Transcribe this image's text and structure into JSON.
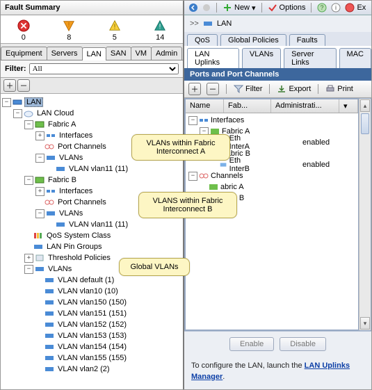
{
  "fault": {
    "title": "Fault Summary",
    "red": "0",
    "orange": "8",
    "yellow": "5",
    "blue": "14"
  },
  "left_tabs": [
    "Equipment",
    "Servers",
    "LAN",
    "SAN",
    "VM",
    "Admin"
  ],
  "left_tab_selected": 2,
  "filter_label": "Filter:",
  "filter_value": "All",
  "tree": {
    "root": "LAN",
    "cloud": "LAN Cloud",
    "fabricA": "Fabric A",
    "interfaces": "Interfaces",
    "portchannels": "Port Channels",
    "vlans": "VLANs",
    "vlan11A": "VLAN vlan11 (11)",
    "fabricB": "Fabric B",
    "vlan11B": "VLAN vlan11 (11)",
    "qos": "QoS System Class",
    "pin": "LAN Pin Groups",
    "thresh": "Threshold Policies",
    "vlans_global": "VLANs",
    "globals": [
      "VLAN default (1)",
      "VLAN vlan10 (10)",
      "VLAN vlan150 (150)",
      "VLAN vlan151 (151)",
      "VLAN vlan152 (152)",
      "VLAN vlan153 (153)",
      "VLAN vlan154 (154)",
      "VLAN vlan155 (155)",
      "VLAN vlan2 (2)"
    ]
  },
  "callouts": {
    "a": "VLANs within Fabric Interconnect A",
    "b": "VLANS within Fabric Interconnect B",
    "g": "Global VLANs"
  },
  "r_toolbar": {
    "new": "New",
    "options": "Options",
    "exit": "Ex"
  },
  "breadcrumb": "LAN",
  "r_tabs_top": [
    "QoS",
    "Global Policies",
    "Faults"
  ],
  "r_tabs_bottom": [
    "LAN Uplinks",
    "VLANs",
    "Server Links",
    "MAC"
  ],
  "r_tab_bottom_selected": 0,
  "section": "Ports and Port Channels",
  "r_tools": {
    "filter": "Filter",
    "export": "Export",
    "print": "Print"
  },
  "grid_cols": [
    "Name",
    "Fab...",
    "Administrati..."
  ],
  "grid_rows": {
    "interfaces": "Interfaces",
    "fabricA": "Fabric A",
    "ethA": "Eth InterA",
    "ethA_state": "enabled",
    "fabricB": "Fabric B",
    "ethB": "Eth InterB",
    "ethB_state": "enabled",
    "channels": "Channels",
    "chA": "abric A",
    "chB": "abric B"
  },
  "btn_enable": "Enable",
  "btn_disable": "Disable",
  "foot_text": "To configure the LAN, launch the ",
  "foot_link": "LAN Uplinks Manager",
  "foot_dot": "."
}
